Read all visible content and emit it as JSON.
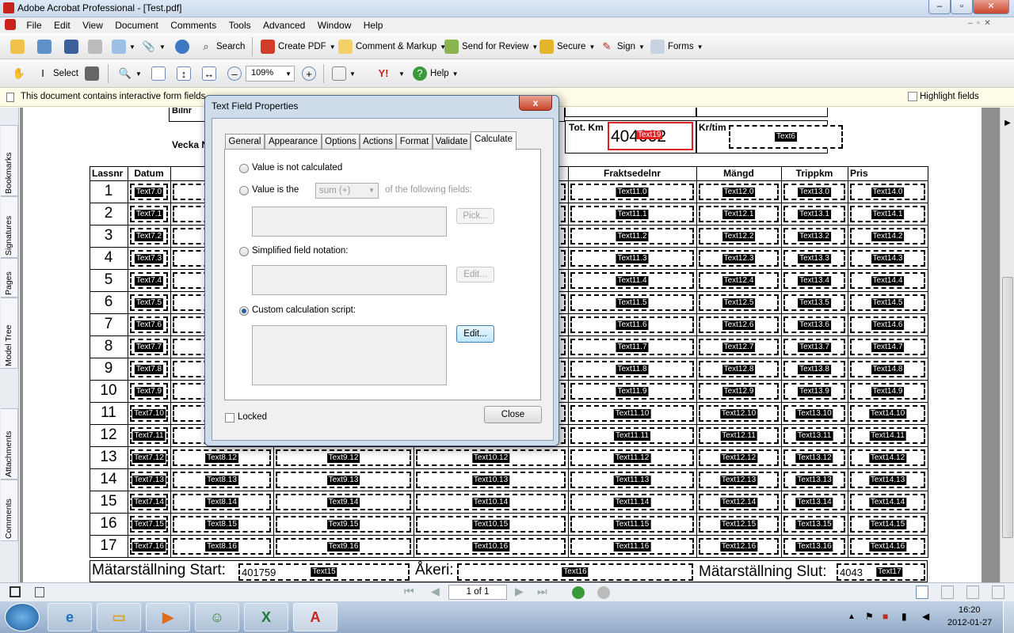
{
  "window": {
    "title": "Adobe Acrobat Professional - [Test.pdf]"
  },
  "menu": [
    "File",
    "Edit",
    "View",
    "Document",
    "Comments",
    "Tools",
    "Advanced",
    "Window",
    "Help"
  ],
  "toolbar1": {
    "search": "Search",
    "create_pdf": "Create PDF",
    "comment_markup": "Comment & Markup",
    "send_review": "Send for Review",
    "secure": "Secure",
    "sign": "Sign",
    "forms": "Forms"
  },
  "toolbar2": {
    "select": "Select",
    "zoom": "109%",
    "help": "Help"
  },
  "infobar": {
    "message": "This document contains interactive form fields.",
    "highlight": "Highlight fields"
  },
  "nav_tabs": [
    "Bookmarks",
    "Signatures",
    "Pages",
    "Model Tree",
    "Attachments",
    "Comments"
  ],
  "form": {
    "top_labels": {
      "datum_cut": "Bilnr",
      "vecka": "Vecka N",
      "tot_km": "Tot. Km",
      "kr_tim": "Kr/tim"
    },
    "tot_km_value": "404002",
    "tot_km_field": "Text19",
    "kr_tim_field": "Text6",
    "headers": [
      "Lassnr",
      "Datum",
      "",
      "",
      "",
      "Fraktsedelnr",
      "Mängd",
      "Trippkm",
      "Pris"
    ],
    "rows": [
      {
        "n": "1",
        "f": [
          "Text7.0",
          "",
          "",
          "",
          "Text11.0",
          "Text12.0",
          "Text13.0",
          "Text14.0"
        ]
      },
      {
        "n": "2",
        "f": [
          "Text7.1",
          "",
          "",
          "",
          "Text11.1",
          "Text12.1",
          "Text13.1",
          "Text14.1"
        ]
      },
      {
        "n": "3",
        "f": [
          "Text7.2",
          "",
          "",
          "",
          "Text11.2",
          "Text12.2",
          "Text13.2",
          "Text14.2"
        ]
      },
      {
        "n": "4",
        "f": [
          "Text7.3",
          "",
          "",
          "",
          "Text11.3",
          "Text12.3",
          "Text13.3",
          "Text14.3"
        ]
      },
      {
        "n": "5",
        "f": [
          "Text7.4",
          "",
          "",
          "",
          "Text11.4",
          "Text12.4",
          "Text13.4",
          "Text14.4"
        ]
      },
      {
        "n": "6",
        "f": [
          "Text7.5",
          "",
          "",
          "",
          "Text11.5",
          "Text12.5",
          "Text13.5",
          "Text14.5"
        ]
      },
      {
        "n": "7",
        "f": [
          "Text7.6",
          "",
          "",
          "",
          "Text11.6",
          "Text12.6",
          "Text13.6",
          "Text14.6"
        ]
      },
      {
        "n": "8",
        "f": [
          "Text7.7",
          "",
          "",
          "",
          "Text11.7",
          "Text12.7",
          "Text13.7",
          "Text14.7"
        ]
      },
      {
        "n": "9",
        "f": [
          "Text7.8",
          "",
          "",
          "",
          "Text11.8",
          "Text12.8",
          "Text13.8",
          "Text14.8"
        ]
      },
      {
        "n": "10",
        "f": [
          "Text7.9",
          "",
          "",
          "",
          "Text11.9",
          "Text12.9",
          "Text13.9",
          "Text14.9"
        ]
      },
      {
        "n": "11",
        "f": [
          "Text7.10",
          "",
          "",
          "",
          "Text11.10",
          "Text12.10",
          "Text13.10",
          "Text14.10"
        ]
      },
      {
        "n": "12",
        "f": [
          "Text7.11",
          "",
          "",
          "",
          "Text11.11",
          "Text12.11",
          "Text13.11",
          "Text14.11"
        ]
      },
      {
        "n": "13",
        "f": [
          "Text7.12",
          "Text8.12",
          "Text9.12",
          "Text10.12",
          "Text11.12",
          "Text12.12",
          "Text13.12",
          "Text14.12"
        ]
      },
      {
        "n": "14",
        "f": [
          "Text7.13",
          "Text8.13",
          "Text9.13",
          "Text10.13",
          "Text11.13",
          "Text12.13",
          "Text13.13",
          "Text14.13"
        ]
      },
      {
        "n": "15",
        "f": [
          "Text7.14",
          "Text8.14",
          "Text9.14",
          "Text10.14",
          "Text11.14",
          "Text12.14",
          "Text13.14",
          "Text14.14"
        ]
      },
      {
        "n": "16",
        "f": [
          "Text7.15",
          "Text8.15",
          "Text9.15",
          "Text10.15",
          "Text11.15",
          "Text12.15",
          "Text13.15",
          "Text14.15"
        ]
      },
      {
        "n": "17",
        "f": [
          "Text7.16",
          "Text8.16",
          "Text9.16",
          "Text10.16",
          "Text11.16",
          "Text12.16",
          "Text13.16",
          "Text14.16"
        ]
      }
    ],
    "footer": {
      "start_label": "Mätarställning Start:",
      "start_value": "401759",
      "start_field": "Text15",
      "akeri_label": "Åkeri:",
      "akeri_field": "Text16",
      "slut_label": "Mätarställning Slut:",
      "slut_value": "4043",
      "slut_field": "Text17"
    }
  },
  "dialog": {
    "title": "Text Field Properties",
    "close": "x",
    "tabs": [
      "General",
      "Appearance",
      "Options",
      "Actions",
      "Format",
      "Validate",
      "Calculate"
    ],
    "active_tab": "Calculate",
    "opt_not_calc": "Value is not calculated",
    "opt_value_is": "Value is the",
    "func_select": "sum (+)",
    "of_fields": "of the following fields:",
    "pick": "Pick...",
    "opt_simplified": "Simplified field notation:",
    "edit_disabled": "Edit...",
    "opt_custom": "Custom calculation script:",
    "edit": "Edit...",
    "locked": "Locked",
    "close_btn": "Close"
  },
  "status": {
    "page": "1 of 1"
  },
  "taskbar": {
    "time": "16:20",
    "date": "2012-01-27"
  }
}
